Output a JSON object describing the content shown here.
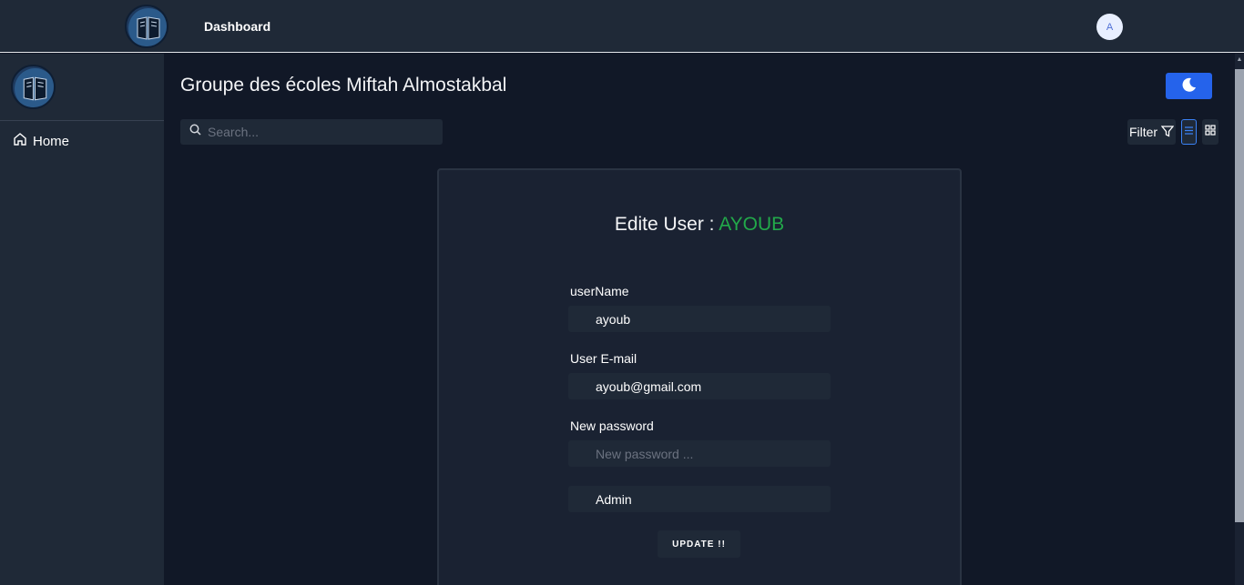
{
  "topbar": {
    "nav_link": "Dashboard",
    "avatar_initial": "A"
  },
  "sidebar": {
    "items": [
      {
        "label": "Home",
        "icon": "home-icon"
      }
    ]
  },
  "main": {
    "title": "Groupe des écoles Miftah Almostakbal",
    "search_placeholder": "Search...",
    "filter_label": "Filter"
  },
  "form": {
    "title_prefix": "Edite User : ",
    "title_user": "AYOUB",
    "username_label": "userName",
    "username_value": "ayoub",
    "email_label": "User E-mail",
    "email_value": "ayoub@gmail.com",
    "password_label": "New password",
    "password_placeholder": "New password ...",
    "role_value": "Admin",
    "update_label": "UPDATE !!"
  },
  "colors": {
    "accent": "#2563eb",
    "username_highlight": "#22a94a",
    "background": "#111827",
    "panel": "#1f2937"
  }
}
